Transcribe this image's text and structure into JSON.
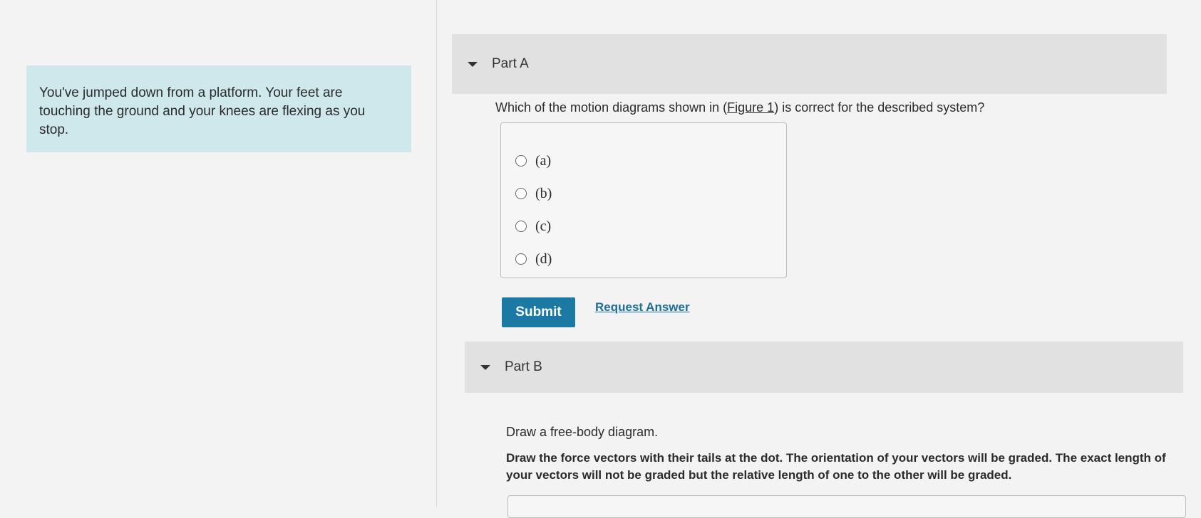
{
  "problem": {
    "text": "You've jumped down from a platform. Your feet are touching the ground and your knees are flexing as you stop."
  },
  "part_a": {
    "title": "Part A",
    "question_before": "Which of the motion diagrams shown in (",
    "figure_link": "Figure 1",
    "question_after": ") is correct for the described system?",
    "options": [
      "(a)",
      "(b)",
      "(c)",
      "(d)"
    ],
    "submit_label": "Submit",
    "request_answer_label": "Request Answer"
  },
  "part_b": {
    "title": "Part B",
    "prompt": "Draw a free-body diagram.",
    "instructions": "Draw the force vectors with their tails at the dot. The orientation of your vectors will be graded. The exact length of your vectors will not be graded but the relative length of one to the other will be graded."
  },
  "colors": {
    "problem_bg": "#cfe8ec",
    "header_bg": "#e1e1e1",
    "submit_bg": "#1b7aa3",
    "link": "#1b6f9a"
  }
}
